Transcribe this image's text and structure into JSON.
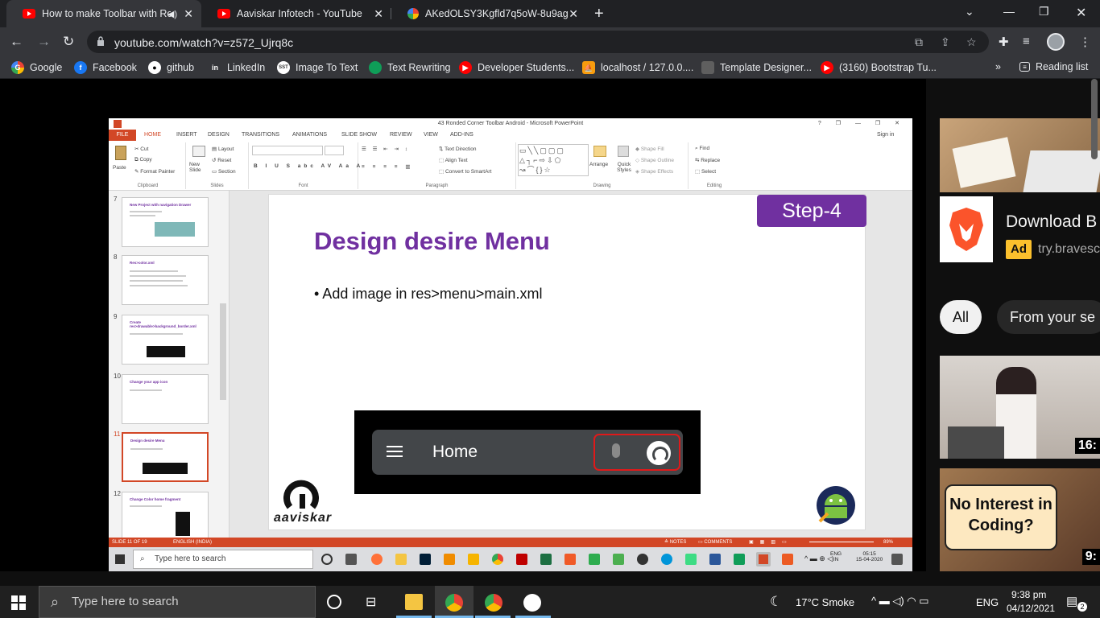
{
  "browser": {
    "tabs": [
      {
        "title": "How to make Toolbar with Ro",
        "active": true,
        "icon": "youtube-icon",
        "audio": true
      },
      {
        "title": "Aaviskar Infotech - YouTube",
        "active": false,
        "icon": "youtube-icon"
      },
      {
        "title": "AKedOLSY3Kgfld7q5oW-8u9agD",
        "active": false,
        "icon": "photos-icon"
      }
    ],
    "url": "youtube.com/watch?v=z572_Ujrq8c",
    "bookmarks": [
      {
        "label": "Google",
        "icon": "google-icon"
      },
      {
        "label": "Facebook",
        "icon": "facebook-icon"
      },
      {
        "label": "github",
        "icon": "github-icon"
      },
      {
        "label": "LinkedIn",
        "icon": "linkedin-icon"
      },
      {
        "label": "Image To Text",
        "icon": "sst-icon"
      },
      {
        "label": "Text Rewriting",
        "icon": "rewrite-icon"
      },
      {
        "label": "Developer Students...",
        "icon": "youtube-icon"
      },
      {
        "label": "localhost / 127.0.0....",
        "icon": "phpmyadmin-icon"
      },
      {
        "label": "Template Designer...",
        "icon": "template-icon"
      },
      {
        "label": "(3160) Bootstrap Tu...",
        "icon": "youtube-icon"
      }
    ],
    "reading_list": "Reading list",
    "overflow": "»"
  },
  "ppt": {
    "window_title": "43 Ronded Corner Toolbar Android - Microsoft PowerPoint",
    "file_tab": "FILE",
    "tabs": [
      "HOME",
      "INSERT",
      "DESIGN",
      "TRANSITIONS",
      "ANIMATIONS",
      "SLIDE SHOW",
      "REVIEW",
      "VIEW",
      "ADD-INS"
    ],
    "sign_in": "Sign in",
    "ribbon": {
      "paste": "Paste",
      "cut": "Cut",
      "copy": "Copy",
      "format_painter": "Format Painter",
      "clipboard": "Clipboard",
      "new_slide": "New Slide",
      "layout": "Layout",
      "reset": "Reset",
      "section": "Section",
      "slides": "Slides",
      "font": "Font",
      "text_direction": "Text Direction",
      "align_text": "Align Text",
      "convert_smartart": "Convert to SmartArt",
      "paragraph": "Paragraph",
      "arrange": "Arrange",
      "quick_styles": "Quick Styles",
      "shape_fill": "Shape Fill",
      "shape_outline": "Shape Outline",
      "shape_effects": "Shape Effects",
      "drawing": "Drawing",
      "find": "Find",
      "replace": "Replace",
      "select": "Select",
      "editing": "Editing"
    },
    "thumbnails": [
      {
        "num": "7",
        "title": "New Project with navigation Drawer"
      },
      {
        "num": "8",
        "title": "Res>color.xml"
      },
      {
        "num": "9",
        "title": "Create res>drawable>background_border.xml"
      },
      {
        "num": "10",
        "title": "Change your app icon"
      },
      {
        "num": "11",
        "title": "Design desire Menu"
      },
      {
        "num": "12",
        "title": "Change Color home fragment"
      }
    ],
    "slide": {
      "badge": "Step-4",
      "title": "Design desire Menu",
      "bullet": "• Add image in res>menu>main.xml",
      "toolbar_home": "Home",
      "brand": "aaviskar"
    },
    "status": {
      "slide_info": "SLIDE 11 OF 19",
      "language": "ENGLISH (INDIA)",
      "notes": "NOTES",
      "comments": "COMMENTS",
      "zoom": "89%"
    },
    "taskbar": {
      "search": "Type here to search",
      "lang": "ENG",
      "region": "IN",
      "time": "05:15",
      "date": "15-04-2020"
    }
  },
  "sidebar": {
    "ad_title": "Download B",
    "ad_badge": "Ad",
    "ad_url": "try.bravesc",
    "chips": [
      "All",
      "From your se"
    ],
    "videos": [
      {
        "duration": "16:"
      },
      {
        "title": "No Interest in Coding?",
        "duration": "9:"
      }
    ]
  },
  "taskbar": {
    "search": "Type here to search",
    "weather": "17°C  Smoke",
    "lang": "ENG",
    "time": "9:38 pm",
    "date": "04/12/2021",
    "notifications": "2"
  }
}
